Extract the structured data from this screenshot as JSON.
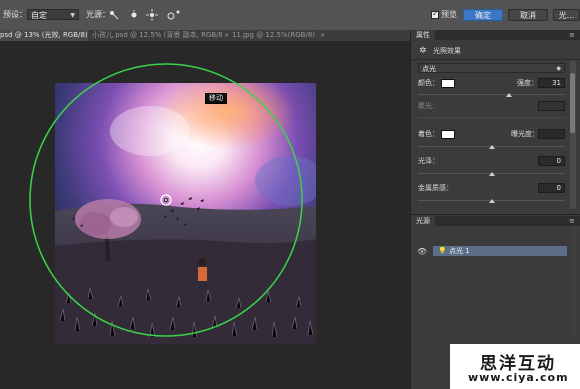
{
  "options_bar": {
    "preset_label": "预设：",
    "preset_value": "自定",
    "light_label": "光源：",
    "preview_label": "预览",
    "preview_checked": true,
    "ok_label": "确定",
    "cancel_label": "取消",
    "partial_right_label": "光..."
  },
  "tabs": [
    {
      "label": "psd @ 13% (光效, RGB/8) *",
      "active": true
    },
    {
      "label": "小孩儿.psd @ 12.5% (背景 副本, RGB/8)",
      "active": false
    },
    {
      "label": "11.jpg @ 12.5%(RGB/8)",
      "active": false
    }
  ],
  "canvas": {
    "tooltip": "移动"
  },
  "properties": {
    "panel_tab": "属性",
    "title": "光照效果",
    "light_type": "点光",
    "color_label": "颜色：",
    "intensity_label": "强度：",
    "intensity_value": "31",
    "intensity_level": 0.62,
    "hotspot_label": "聚光：",
    "tint_label": "着色：",
    "exposure_label": "曝光度：",
    "exposure_level": 0.5,
    "gloss_label": "光泽：",
    "gloss_value": "0",
    "gloss_level": 0.5,
    "metallic_label": "金属质感：",
    "metallic_value": "0",
    "metallic_level": 0.5,
    "color_hex": "#ffffff",
    "tint_hex": "#ffffff"
  },
  "lights": {
    "panel_tab": "光源",
    "items": [
      {
        "name": "点光 1",
        "visible": true,
        "selected": true
      }
    ]
  },
  "watermark": {
    "line1": "思洋互动",
    "line2": "www.ciya.com"
  },
  "colors": {
    "accent": "#3a78c4",
    "selection_ring": "#3bd34a",
    "panel_bg": "#3b3b3b",
    "selected_layer": "#5c6e85"
  }
}
